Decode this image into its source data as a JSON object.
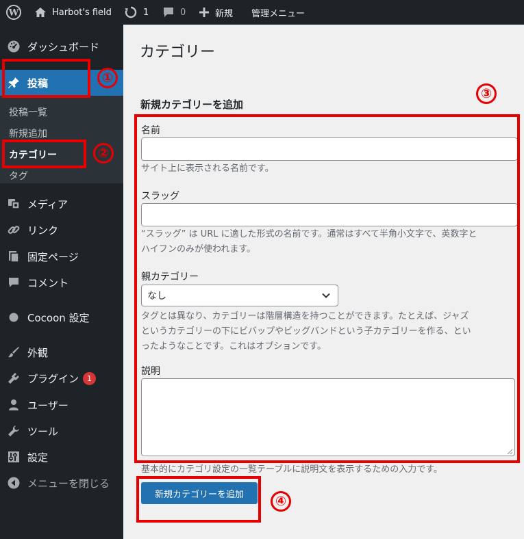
{
  "admin_bar": {
    "site_name": "Harbot's field",
    "updates_count": "1",
    "comments_count": "0",
    "new_label": "新規",
    "admin_menu_label": "管理メニュー"
  },
  "sidebar": {
    "dashboard": "ダッシュボード",
    "posts": "投稿",
    "posts_submenu": [
      "投稿一覧",
      "新規追加",
      "カテゴリー",
      "タグ"
    ],
    "media": "メディア",
    "links": "リンク",
    "pages": "固定ページ",
    "comments": "コメント",
    "cocoon": "Cocoon 設定",
    "appearance": "外観",
    "plugins": "プラグイン",
    "plugins_badge": "1",
    "users": "ユーザー",
    "tools": "ツール",
    "settings": "設定",
    "collapse": "メニューを閉じる"
  },
  "main": {
    "title": "カテゴリー",
    "form_heading": "新規カテゴリーを追加",
    "name_label": "名前",
    "name_value": "",
    "name_help": "サイト上に表示される名前です。",
    "slug_label": "スラッグ",
    "slug_value": "",
    "slug_help_line1": "“スラッグ” は URL に適した形式の名前です。通常はすべて半角小文字で、英数字と",
    "slug_help_line2": "ハイフンのみが使われます。",
    "parent_label": "親カテゴリー",
    "parent_selected": "なし",
    "parent_help_line1": "タグとは異なり、カテゴリーは階層構造を持つことができます。たとえば、ジャズ",
    "parent_help_line2": "というカテゴリーの下にビバップやビッグバンドという子カテゴリーを作る、とい",
    "parent_help_line3": "ったようなことです。これはオプションです。",
    "description_label": "説明",
    "description_value": "",
    "description_help": "基本的にカテゴリ設定の一覧テーブルに説明文を表示するための入力です。",
    "submit_label": "新規カテゴリーを追加"
  },
  "annotations": [
    "①",
    "②",
    "③",
    "④"
  ],
  "colors": {
    "admin_dark": "#1d2327",
    "submenu_bg": "#2c3338",
    "accent_blue": "#2271b1",
    "annotation_red": "#e60000",
    "badge_red": "#d63638"
  }
}
